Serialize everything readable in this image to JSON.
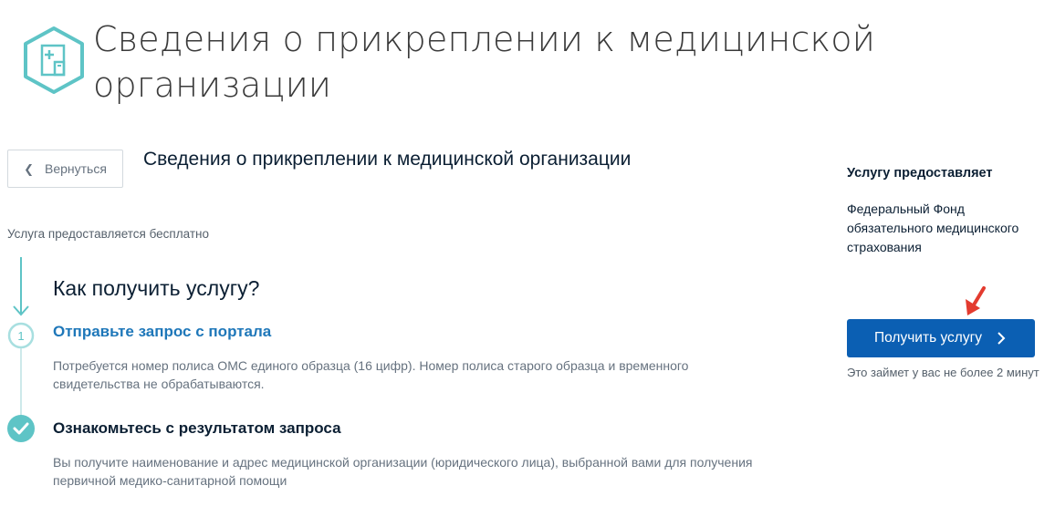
{
  "header": {
    "title": "Сведения о прикреплении к медицинской организации",
    "logo_icon": "medical-building-hex-icon"
  },
  "nav": {
    "back_label": "Вернуться",
    "back_icon": "chevron-left-icon"
  },
  "service": {
    "title": "Сведения о прикреплении к медицинской организации",
    "free_note": "Услуга предоставляется бесплатно"
  },
  "how_to": {
    "title": "Как получить услугу?",
    "steps": [
      {
        "number": "1",
        "title": "Отправьте запрос с портала",
        "description": "Потребуется номер полиса ОМС единого образца (16 цифр). Номер полиса старого образца и временного свидетельства не обрабатываются."
      },
      {
        "icon": "checkmark-icon",
        "title": "Ознакомьтесь с результатом запроса",
        "description": "Вы получите наименование и адрес медицинской организации (юридического лица), выбранной вами для получения первичной медико-санитарной помощи"
      }
    ]
  },
  "sidebar": {
    "provider_label": "Услугу предоставляет",
    "provider_name": "Федеральный Фонд обязательного медицинского страхования",
    "cta_label": "Получить услугу",
    "time_note": "Это займет у вас не более 2 минут"
  },
  "colors": {
    "accent_teal": "#5ec4c6",
    "link_blue": "#1e77b9",
    "button_blue": "#0b5fb3",
    "annotation_red": "#e33b2f"
  }
}
